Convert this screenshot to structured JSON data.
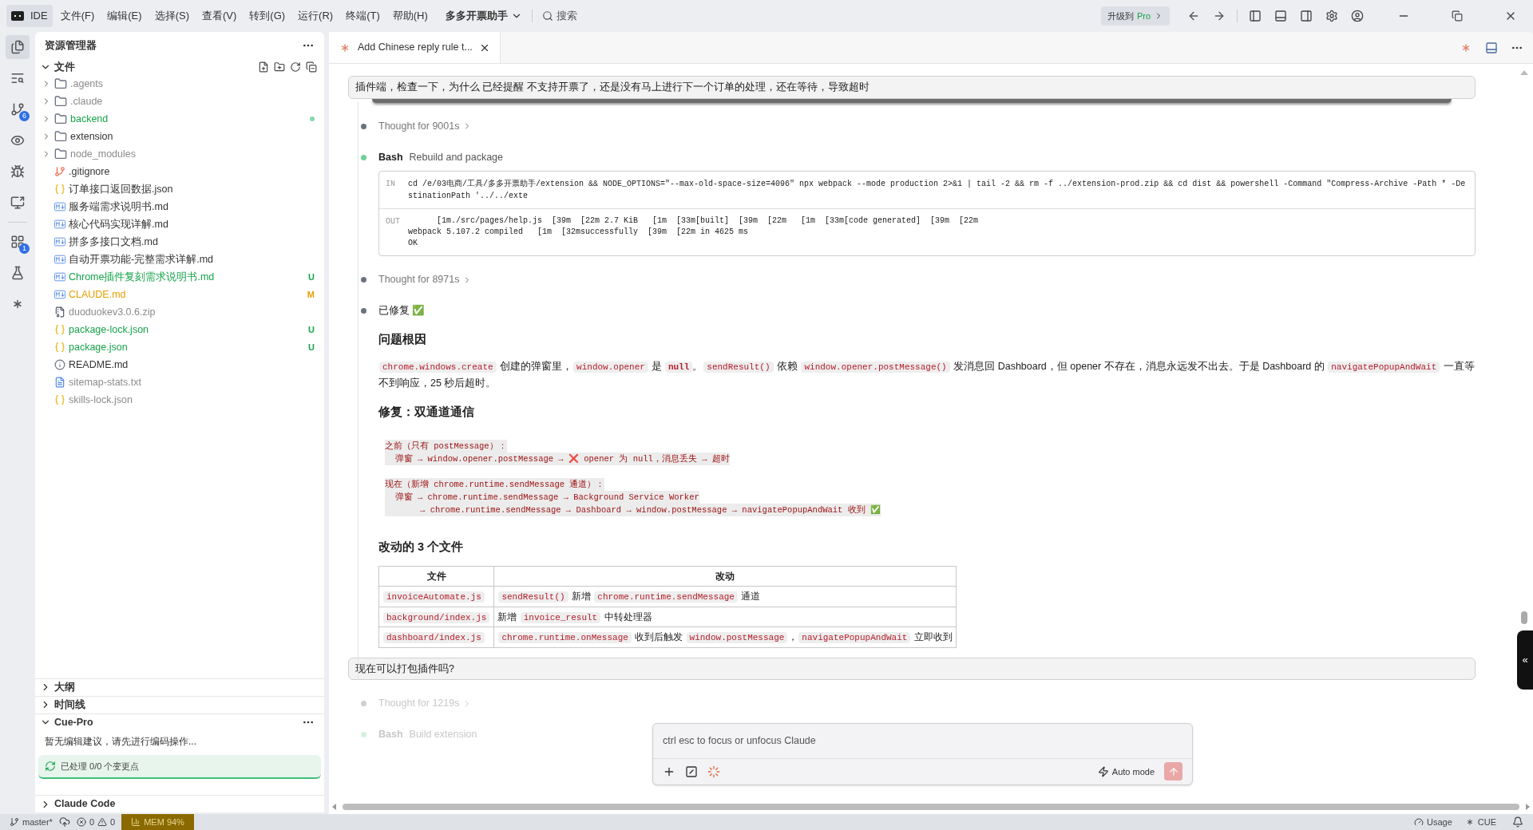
{
  "titlebar": {
    "app": "IDE",
    "menus": [
      "文件(F)",
      "编辑(E)",
      "选择(S)",
      "查看(V)",
      "转到(G)",
      "运行(R)",
      "终端(T)",
      "帮助(H)"
    ],
    "project": "多多开票助手",
    "search": "搜索",
    "upgrade": "升级到",
    "upgrade_badge": "Pro"
  },
  "activity_bar": [
    {
      "kind": "files",
      "selected": true
    },
    {
      "kind": "search",
      "selected": false
    },
    {
      "kind": "git",
      "selected": false,
      "badge": "6"
    },
    {
      "kind": "eye",
      "selected": false
    },
    {
      "kind": "bug",
      "selected": false
    },
    {
      "kind": "remote",
      "selected": false
    },
    {
      "kind": "extensions",
      "selected": false,
      "badge": "1"
    },
    {
      "kind": "flask",
      "selected": false
    },
    {
      "kind": "claude",
      "selected": false
    }
  ],
  "sidebar": {
    "title": "资源管理器",
    "section": "文件",
    "expanded": true,
    "tree": [
      {
        "name": ".agents",
        "kind": "folder",
        "color": "#8b8b8b"
      },
      {
        "name": ".claude",
        "kind": "folder",
        "color": "#8b8b8b"
      },
      {
        "name": "backend",
        "kind": "folder",
        "color": "#17a34a",
        "dot": true
      },
      {
        "name": "extension",
        "kind": "folder",
        "color": "#333333"
      },
      {
        "name": "node_modules",
        "kind": "folder",
        "color": "#8b8b8b"
      },
      {
        "name": ".gitignore",
        "kind": "git",
        "color": "#333333"
      },
      {
        "name": "订单接口返回数据.json",
        "kind": "json",
        "color": "#333333"
      },
      {
        "name": "服务端需求说明书.md",
        "kind": "md",
        "color": "#333333"
      },
      {
        "name": "核心代码实现详解.md",
        "kind": "md",
        "color": "#333333"
      },
      {
        "name": "拼多多接口文档.md",
        "kind": "md",
        "color": "#333333"
      },
      {
        "name": "自动开票功能-完整需求详解.md",
        "kind": "md",
        "color": "#333333"
      },
      {
        "name": "Chrome插件复刻需求说明书.md",
        "kind": "md",
        "color": "#17a34a",
        "badge": "U"
      },
      {
        "name": "CLAUDE.md",
        "kind": "md",
        "color": "#e5a000",
        "badge": "M"
      },
      {
        "name": "duoduokev3.0.6.zip",
        "kind": "zip",
        "color": "#8b8b8b"
      },
      {
        "name": "package-lock.json",
        "kind": "json",
        "color": "#17a34a",
        "badge": "U"
      },
      {
        "name": "package.json",
        "kind": "json",
        "color": "#17a34a",
        "badge": "U"
      },
      {
        "name": "README.md",
        "kind": "info",
        "color": "#333333"
      },
      {
        "name": "sitemap-stats.txt",
        "kind": "txt",
        "color": "#8b8b8b"
      },
      {
        "name": "skills-lock.json",
        "kind": "json",
        "color": "#8b8b8b"
      }
    ],
    "panels": [
      {
        "title": "大纲",
        "expanded": false
      },
      {
        "title": "时间线",
        "expanded": false
      },
      {
        "title": "Cue-Pro",
        "expanded": true,
        "text": "暂无编辑建议，请先进行编码操作...",
        "button": "已处理 0/0 个变更点"
      },
      {
        "title": "Claude Code",
        "expanded": false
      }
    ]
  },
  "editor_tab": {
    "title": "Add Chinese reply rule t...",
    "selected": true
  },
  "chat": [
    {
      "kind": "user",
      "text": "插件端，检查一下，为什么 已经提醒 不支持开票了，还是没有马上进行下一个订单的处理，还在等待，导致超时"
    },
    {
      "kind": "thought",
      "text": "Thought for 9001s",
      "color": "#6b7280"
    },
    {
      "kind": "tool",
      "tool": "Bash",
      "text": "Rebuild and package",
      "color": "#6fcf97",
      "in_label": "IN",
      "in": "cd /e/03电商/工具/多多开票助手/extension && NODE_OPTIONS=\"--max-old-space-size=4096\" npx webpack --mode production 2>&1 | tail -2 && rm -f ../extension-prod.zip && cd dist && powershell -Command \"Compress-Archive -Path * -DestinationPath '../../exte",
      "out_label": "OUT",
      "out": [
        "      [1m./src/pages/help.js  [39m  [22m 2.7 KiB   [1m  [33m[built]  [39m  [22m   [1m  [33m[code generated]  [39m  [22m",
        "webpack 5.107.2 compiled   [1m  [32msuccessfully  [39m  [22m in 4625 ms",
        "OK"
      ]
    },
    {
      "kind": "thought",
      "text": "Thought for 8971s",
      "color": "#6b7280"
    },
    {
      "kind": "status",
      "text": "已修复 ✅",
      "color": "#6b7280"
    },
    {
      "kind": "heading",
      "text": "问题根因"
    },
    {
      "kind": "paragraph",
      "segments": [
        {
          "kind": "code",
          "text": "chrome.windows.create"
        },
        {
          "kind": "text",
          "text": " 创建的弹窗里，"
        },
        {
          "kind": "code",
          "text": "window.opener"
        },
        {
          "kind": "text",
          "text": " 是 "
        },
        {
          "kind": "strong_code",
          "text": "null"
        },
        {
          "kind": "text",
          "text": "。"
        },
        {
          "kind": "code",
          "text": "sendResult()"
        },
        {
          "kind": "text",
          "text": " 依赖 "
        },
        {
          "kind": "code",
          "text": "window.opener.postMessage()"
        },
        {
          "kind": "text",
          "text": " 发消息回 Dashboard，但 opener 不存在，消息永远发不出去。于是 Dashboard 的 "
        },
        {
          "kind": "code",
          "text": "navigatePopupAndWait"
        },
        {
          "kind": "text",
          "text": " 一直等不到响应，25 秒后超时。"
        }
      ]
    },
    {
      "kind": "heading",
      "text": "修复：双通道通信"
    },
    {
      "kind": "codeblock",
      "groups": [
        [
          "之前（只有 postMessage）：",
          "  弹窗 → window.opener.postMessage → ❌ opener 为 null，消息丢失 → 超时"
        ],
        [
          "现在（新增 chrome.runtime.sendMessage 通道）：",
          "  弹窗 → chrome.runtime.sendMessage → Background Service Worker",
          "       → chrome.runtime.sendMessage → Dashboard → window.postMessage → navigatePopupAndWait 收到 ✅"
        ]
      ]
    },
    {
      "kind": "heading",
      "text": "改动的 3 个文件"
    },
    {
      "kind": "table",
      "columns": [
        "文件",
        "改动"
      ],
      "rows": [
        [
          [
            {
              "kind": "code",
              "text": "invoiceAutomate.js"
            }
          ],
          [
            {
              "kind": "code",
              "text": "sendResult()"
            },
            {
              "kind": "text",
              "text": " 新增 "
            },
            {
              "kind": "code",
              "text": "chrome.runtime.sendMessage"
            },
            {
              "kind": "text",
              "text": " 通道"
            }
          ]
        ],
        [
          [
            {
              "kind": "code",
              "text": "background/index.js"
            }
          ],
          [
            {
              "kind": "text",
              "text": "新增 "
            },
            {
              "kind": "code",
              "text": "invoice_result"
            },
            {
              "kind": "text",
              "text": " 中转处理器"
            }
          ]
        ],
        [
          [
            {
              "kind": "code",
              "text": "dashboard/index.js"
            }
          ],
          [
            {
              "kind": "code",
              "text": "chrome.runtime.onMessage"
            },
            {
              "kind": "text",
              "text": " 收到后触发 "
            },
            {
              "kind": "code",
              "text": "window.postMessage"
            },
            {
              "kind": "text",
              "text": "，"
            },
            {
              "kind": "code",
              "text": "navigatePopupAndWait"
            },
            {
              "kind": "text",
              "text": " 立即收到"
            }
          ]
        ]
      ]
    },
    {
      "kind": "user",
      "text": "现在可以打包插件吗?"
    },
    {
      "kind": "thought",
      "text": "Thought for 1219s",
      "color": "#cfcfcf",
      "faded": true
    },
    {
      "kind": "tool",
      "tool": "Bash",
      "text": "Build extension",
      "color": "#d3f0de",
      "faded": true
    }
  ],
  "input": {
    "placeholder": "ctrl esc to focus or unfocus Claude",
    "mode": "Auto mode"
  },
  "status_bar": {
    "branch": "master*",
    "errors": "0",
    "warnings": "0",
    "memory": "MEM 94%",
    "usage": "Usage",
    "cue": "CUE"
  },
  "side_toggle": "«"
}
